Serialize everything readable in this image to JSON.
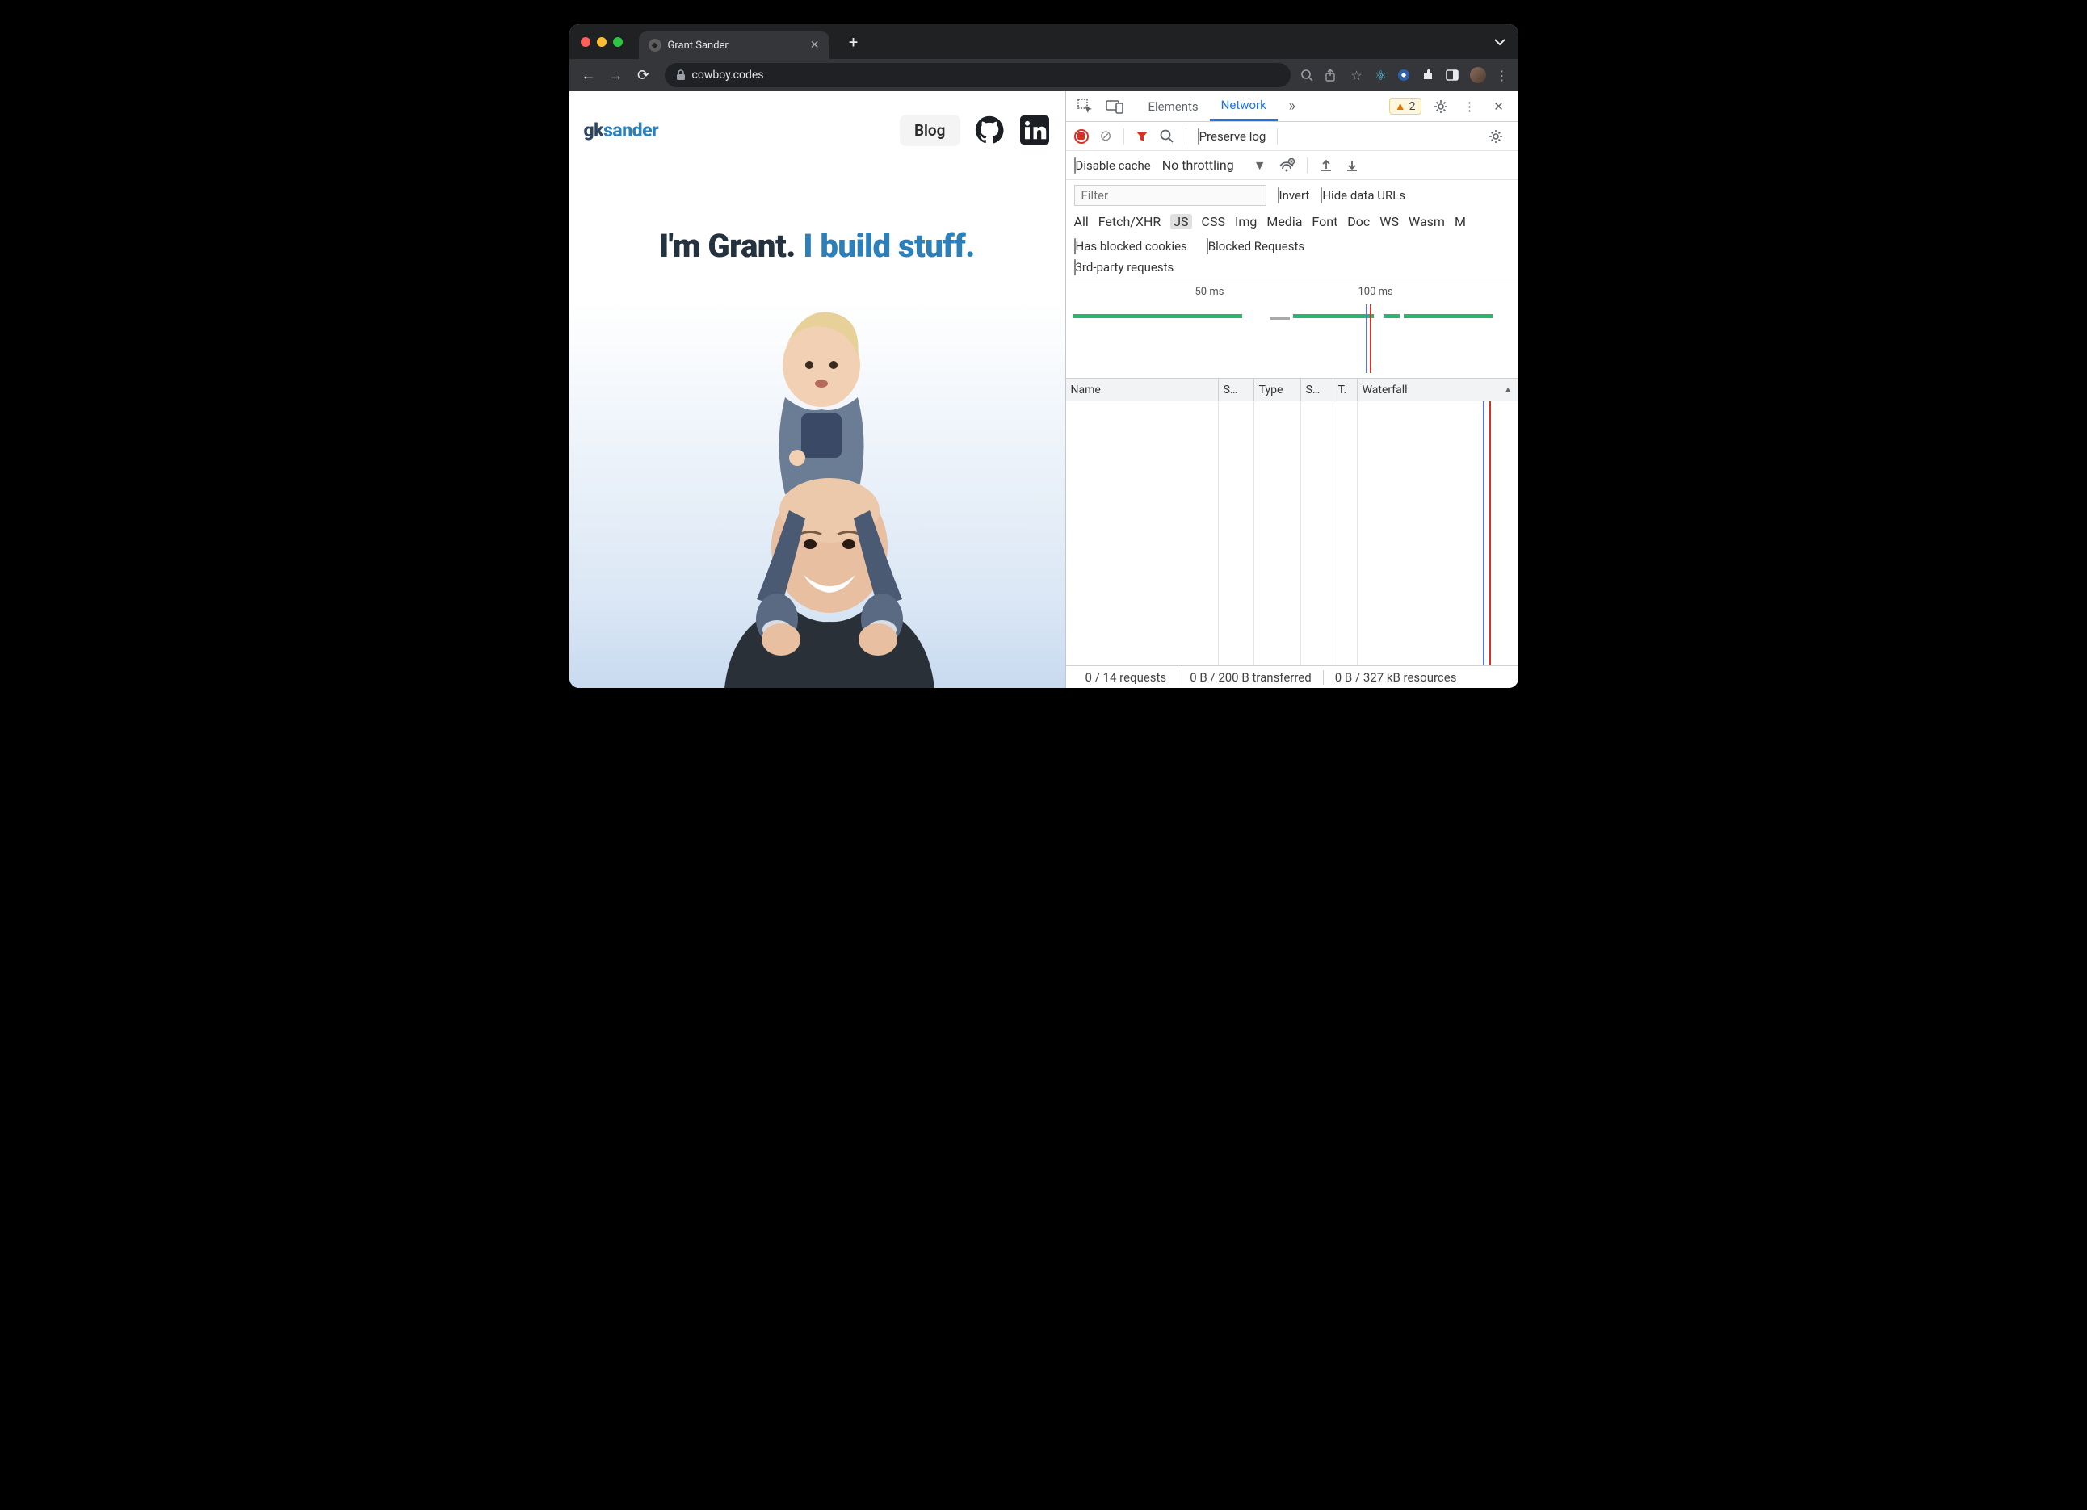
{
  "browser": {
    "tab_title": "Grant Sander",
    "url": "cowboy.codes"
  },
  "page": {
    "logo_prefix": "gk",
    "logo_suffix": "sander",
    "nav": {
      "blog": "Blog"
    },
    "headline_pre": "I'm Grant. ",
    "headline_blue": "I build stuff."
  },
  "devtools": {
    "tabs": {
      "elements": "Elements",
      "network": "Network"
    },
    "warning_count": "2",
    "preserve_log": "Preserve log",
    "disable_cache": "Disable cache",
    "throttling": "No throttling",
    "filter_placeholder": "Filter",
    "invert": "Invert",
    "hide_data_urls": "Hide data URLs",
    "types": {
      "all": "All",
      "fetch": "Fetch/XHR",
      "js": "JS",
      "css": "CSS",
      "img": "Img",
      "media": "Media",
      "font": "Font",
      "doc": "Doc",
      "ws": "WS",
      "wasm": "Wasm",
      "m": "M"
    },
    "has_blocked": "Has blocked cookies",
    "blocked_req": "Blocked Requests",
    "third_party": "3rd-party requests",
    "timeline": {
      "t1": "50 ms",
      "t2": "100 ms"
    },
    "columns": {
      "name": "Name",
      "status": "S…",
      "type": "Type",
      "size": "S…",
      "time": "T.",
      "waterfall": "Waterfall"
    },
    "status": {
      "requests": "0 / 14 requests",
      "transferred": "0 B / 200 B transferred",
      "resources": "0 B / 327 kB resources"
    }
  }
}
